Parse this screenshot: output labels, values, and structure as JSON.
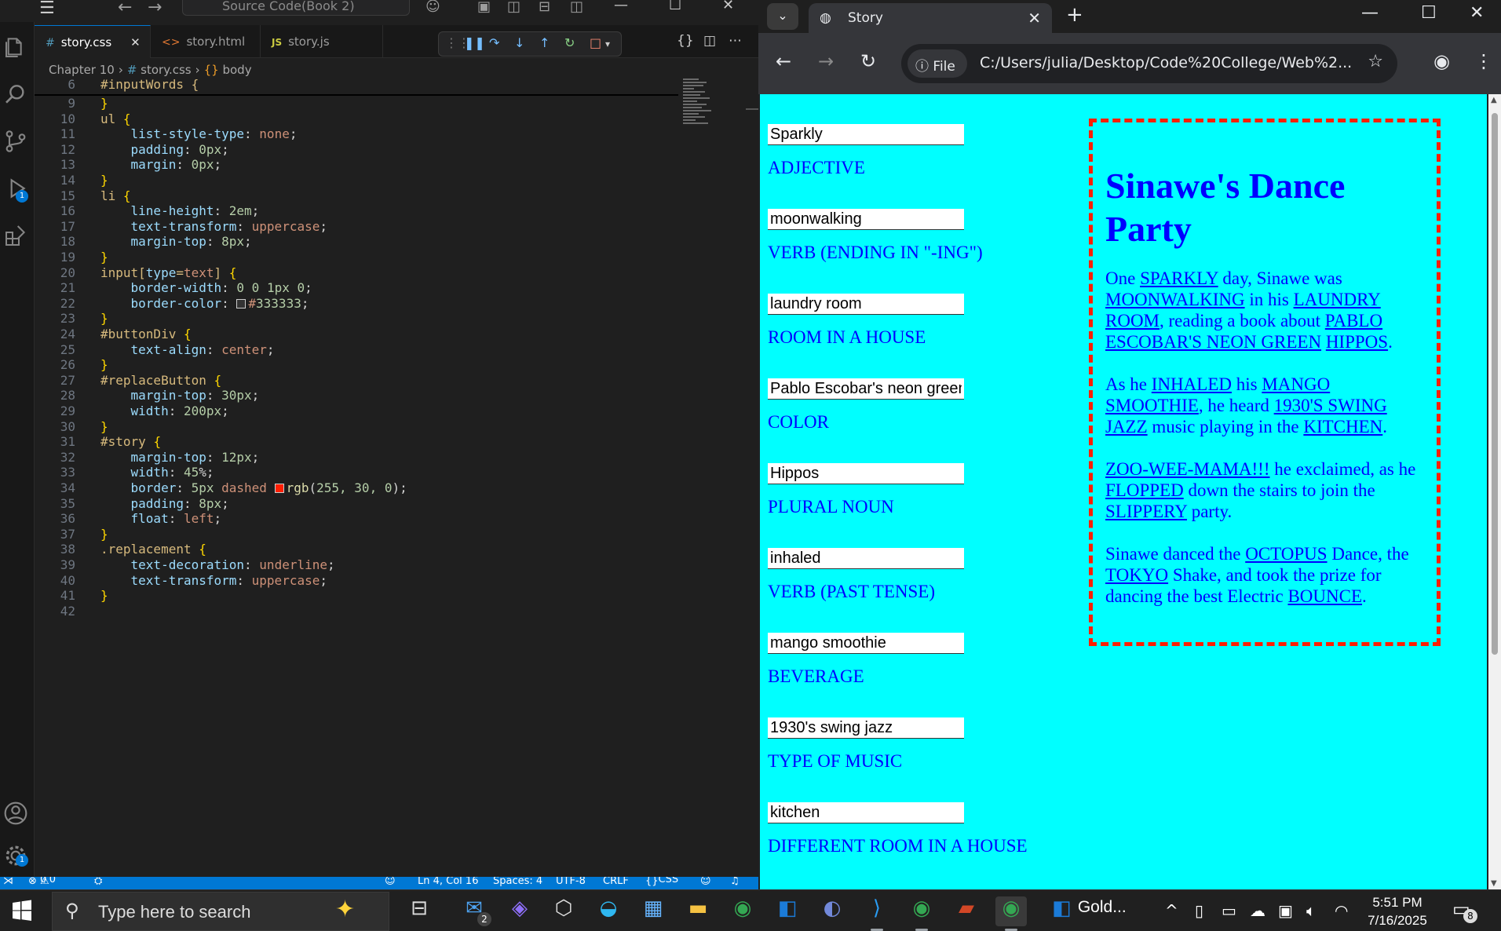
{
  "vscode": {
    "search_text": "Source Code(Book 2)",
    "tabs": [
      {
        "icon": "#",
        "label": "story.css",
        "active": true
      },
      {
        "icon": "<>",
        "label": "story.html"
      },
      {
        "icon": "JS",
        "label": "story.js"
      }
    ],
    "breadcrumb": [
      "Chapter 10",
      "story.css",
      "body"
    ],
    "badges": {
      "run_debug": "1",
      "settings": "1"
    },
    "sticky": {
      "num": "6",
      "text": "#inputWords {"
    },
    "lines": [
      {
        "n": "9",
        "t": "}"
      },
      {
        "n": "10",
        "t": "ul {"
      },
      {
        "n": "11",
        "t": "    list-style-type: none;"
      },
      {
        "n": "12",
        "t": "    padding: 0px;"
      },
      {
        "n": "13",
        "t": "    margin: 0px;"
      },
      {
        "n": "14",
        "t": "}"
      },
      {
        "n": "15",
        "t": "li {"
      },
      {
        "n": "16",
        "t": "    line-height: 2em;"
      },
      {
        "n": "17",
        "t": "    text-transform: uppercase;"
      },
      {
        "n": "18",
        "t": "    margin-top: 8px;"
      },
      {
        "n": "19",
        "t": "}"
      },
      {
        "n": "20",
        "t": "input[type=text] {"
      },
      {
        "n": "21",
        "t": "    border-width: 0 0 1px 0;"
      },
      {
        "n": "22",
        "t": "    border-color: #333333;"
      },
      {
        "n": "23",
        "t": "}"
      },
      {
        "n": "24",
        "t": "#buttonDiv {"
      },
      {
        "n": "25",
        "t": "    text-align: center;"
      },
      {
        "n": "26",
        "t": "}"
      },
      {
        "n": "27",
        "t": "#replaceButton {"
      },
      {
        "n": "28",
        "t": "    margin-top: 30px;"
      },
      {
        "n": "29",
        "t": "    width: 200px;"
      },
      {
        "n": "30",
        "t": "}"
      },
      {
        "n": "31",
        "t": "#story {"
      },
      {
        "n": "32",
        "t": "    margin-top: 12px;"
      },
      {
        "n": "33",
        "t": "    width: 45%;"
      },
      {
        "n": "34",
        "t": "    border: 5px dashed rgb(255, 30, 0);"
      },
      {
        "n": "35",
        "t": "    padding: 8px;"
      },
      {
        "n": "36",
        "t": "    float: left;"
      },
      {
        "n": "37",
        "t": "}"
      },
      {
        "n": "38",
        "t": ".replacement {"
      },
      {
        "n": "39",
        "t": "    text-decoration: underline;"
      },
      {
        "n": "40",
        "t": "    text-transform: uppercase;"
      },
      {
        "n": "41",
        "t": "}"
      },
      {
        "n": "42",
        "t": ""
      }
    ],
    "status": {
      "errors": "0",
      "warnings": "0",
      "cursor": "Ln 4, Col 16",
      "spaces": "Spaces: 4",
      "encoding": "UTF-8",
      "eol": "CRLF",
      "language": "CSS"
    }
  },
  "chrome": {
    "tab_title": "Story",
    "chip_label": "File",
    "url": "C:/Users/julia/Desktop/Code%20College/Web%2..."
  },
  "page": {
    "fields": [
      {
        "value": "Sparkly",
        "label": "Adjective"
      },
      {
        "value": "moonwalking",
        "label": "Verb (ending in \"-ing\")"
      },
      {
        "value": "laundry room",
        "label": "Room in a house"
      },
      {
        "value": "Pablo Escobar's neon green",
        "label": "Color"
      },
      {
        "value": "Hippos",
        "label": "Plural noun"
      },
      {
        "value": "inhaled",
        "label": "Verb (past tense)"
      },
      {
        "value": "mango smoothie",
        "label": "Beverage"
      },
      {
        "value": "1930's swing jazz",
        "label": "Type of music"
      },
      {
        "value": "kitchen",
        "label": "Different room in a house"
      }
    ],
    "story": {
      "title": "Sinawe's Dance Party",
      "paragraphs": [
        [
          {
            "t": "One "
          },
          {
            "t": "Sparkly",
            "r": true
          },
          {
            "t": " day, Sinawe was "
          },
          {
            "t": "moonwalking",
            "r": true
          },
          {
            "t": " in his "
          },
          {
            "t": "laundry room",
            "r": true
          },
          {
            "t": ", reading a book about "
          },
          {
            "t": "Pablo Escobar's neon green",
            "r": true
          },
          {
            "t": " "
          },
          {
            "t": "Hippos",
            "r": true
          },
          {
            "t": "."
          }
        ],
        [
          {
            "t": "As he "
          },
          {
            "t": "inhaled",
            "r": true
          },
          {
            "t": " his "
          },
          {
            "t": "mango smoothie",
            "r": true
          },
          {
            "t": ", he heard "
          },
          {
            "t": "1930's swing jazz",
            "r": true
          },
          {
            "t": " music playing in the "
          },
          {
            "t": "kitchen",
            "r": true
          },
          {
            "t": "."
          }
        ],
        [
          {
            "t": "Zoo-wee-mama!!!",
            "r": true
          },
          {
            "t": " he exclaimed, as he "
          },
          {
            "t": "flopped",
            "r": true
          },
          {
            "t": " down the stairs to join the "
          },
          {
            "t": "slippery",
            "r": true
          },
          {
            "t": " party."
          }
        ],
        [
          {
            "t": "Sinawe danced the "
          },
          {
            "t": "Octopus",
            "r": true
          },
          {
            "t": " Dance, the "
          },
          {
            "t": "Tokyo",
            "r": true
          },
          {
            "t": " Shake, and took the prize for dancing the best Electric "
          },
          {
            "t": "Bounce",
            "r": true
          },
          {
            "t": "."
          }
        ]
      ]
    }
  },
  "taskbar": {
    "search_placeholder": "Type here to search",
    "mail_badge": "2",
    "outlook_label": "Gold...",
    "time": "5:51 PM",
    "date": "7/16/2025",
    "notification_count": "8"
  },
  "colors": {
    "page_bg": "#00ffff",
    "page_text": "#0000ff",
    "story_border": "#ff1e00",
    "vscode_accent": "#0078d4"
  }
}
